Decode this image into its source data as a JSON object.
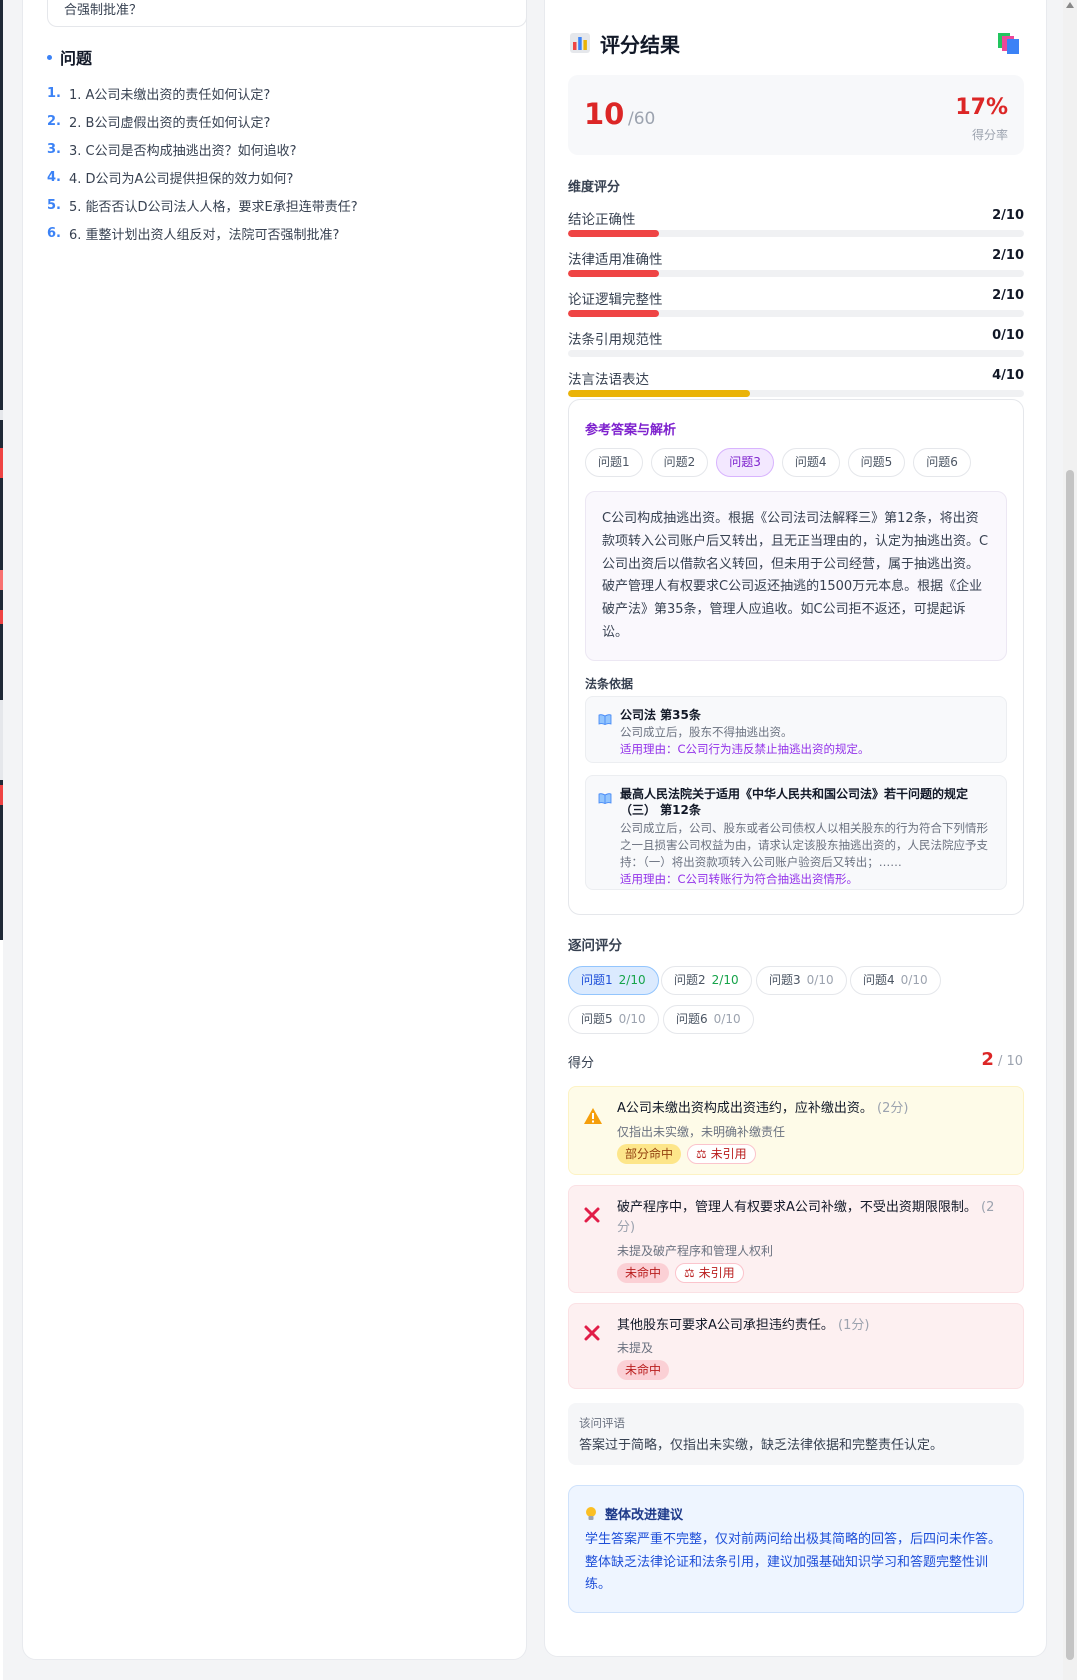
{
  "left": {
    "top_fragment": "合强制批准？",
    "questions_title": "问题",
    "questions": [
      {
        "num": "1.",
        "text": "1. A公司未缴出资的责任如何认定?"
      },
      {
        "num": "2.",
        "text": "2. B公司虚假出资的责任如何认定?"
      },
      {
        "num": "3.",
        "text": "3. C公司是否构成抽逃出资？如何追收?"
      },
      {
        "num": "4.",
        "text": "4. D公司为A公司提供担保的效力如何?"
      },
      {
        "num": "5.",
        "text": "5. 能否否认D公司法人人格，要求E承担连带责任?"
      },
      {
        "num": "6.",
        "text": "6. 重整计划出资人组反对，法院可否强制批准?"
      }
    ]
  },
  "result": {
    "title": "评分结果",
    "score": "10",
    "total": "/60",
    "rate": "17%",
    "rate_label": "得分率",
    "dims_title": "维度评分",
    "dims": [
      {
        "label": "结论正确性",
        "score": "2/10",
        "value": 2,
        "max": 10,
        "color": "#ef4444"
      },
      {
        "label": "法律适用准确性",
        "score": "2/10",
        "value": 2,
        "max": 10,
        "color": "#ef4444"
      },
      {
        "label": "论证逻辑完整性",
        "score": "2/10",
        "value": 2,
        "max": 10,
        "color": "#ef4444"
      },
      {
        "label": "法条引用规范性",
        "score": "0/10",
        "value": 0,
        "max": 10,
        "color": "#ef4444"
      },
      {
        "label": "法言法语表达",
        "score": "4/10",
        "value": 4,
        "max": 10,
        "color": "#eab308"
      }
    ],
    "reference": {
      "title": "参考答案与解析",
      "tabs": [
        "问题1",
        "问题2",
        "问题3",
        "问题4",
        "问题5",
        "问题6"
      ],
      "active_tab": 2,
      "answer": "C公司构成抽逃出资。根据《公司法司法解释三》第12条，将出资款项转入公司账户后又转出，且无正当理由的，认定为抽逃出资。C公司出资后以借款名义转回，但未用于公司经营，属于抽逃出资。破产管理人有权要求C公司返还抽逃的1500万元本息。根据《企业破产法》第35条，管理人应追收。如C公司拒不返还，可提起诉讼。",
      "laws_title": "法条依据",
      "laws": [
        {
          "name": "公司法 第35条",
          "desc": "公司成立后，股东不得抽逃出资。",
          "reason": "适用理由：C公司行为违反禁止抽逃出资的规定。"
        },
        {
          "name": "最高人民法院关于适用《中华人民共和国公司法》若干问题的规定（三） 第12条",
          "desc": "公司成立后，公司、股东或者公司债权人以相关股东的行为符合下列情形之一且损害公司权益为由，请求认定该股东抽逃出资的，人民法院应予支持：（一）将出资款项转入公司账户验资后又转出；……",
          "reason": "适用理由：C公司转账行为符合抽逃出资情形。"
        }
      ]
    },
    "per_question": {
      "title": "逐问评分",
      "tabs": [
        {
          "label": "问题1",
          "score": "2/10"
        },
        {
          "label": "问题2",
          "score": "2/10"
        },
        {
          "label": "问题3",
          "score": "0/10"
        },
        {
          "label": "问题4",
          "score": "0/10"
        },
        {
          "label": "问题5",
          "score": "0/10"
        },
        {
          "label": "问题6",
          "score": "0/10"
        }
      ],
      "score_label": "得分",
      "score": "2",
      "score_total": "/ 10",
      "points": [
        {
          "text": "A公司未缴出资构成出资违约，应补缴出资。",
          "pts": "(2分)",
          "sub": "仅指出未实缴，未明确补缴责任",
          "tag1": "部分命中",
          "tag2": "未引用",
          "status": "warning"
        },
        {
          "text": "破产程序中，管理人有权要求A公司补缴，不受出资期限限制。",
          "pts": "(2分)",
          "sub": "未提及破产程序和管理人权利",
          "tag1": "未命中",
          "tag2": "未引用",
          "status": "miss"
        },
        {
          "text": "其他股东可要求A公司承担违约责任。",
          "pts": "(1分)",
          "sub": "未提及",
          "tag1": "未命中",
          "status": "miss"
        }
      ],
      "comment_label": "该问评语",
      "comment": "答案过于简略，仅指出未实缴，缺乏法律依据和完整责任认定。"
    },
    "suggestion": {
      "title": "整体改进建议",
      "text": "学生答案严重不完整，仅对前两问给出极其简略的回答，后四问未作答。整体缺乏法律论证和法条引用，建议加强基础知识学习和答题完整性训练。"
    }
  }
}
